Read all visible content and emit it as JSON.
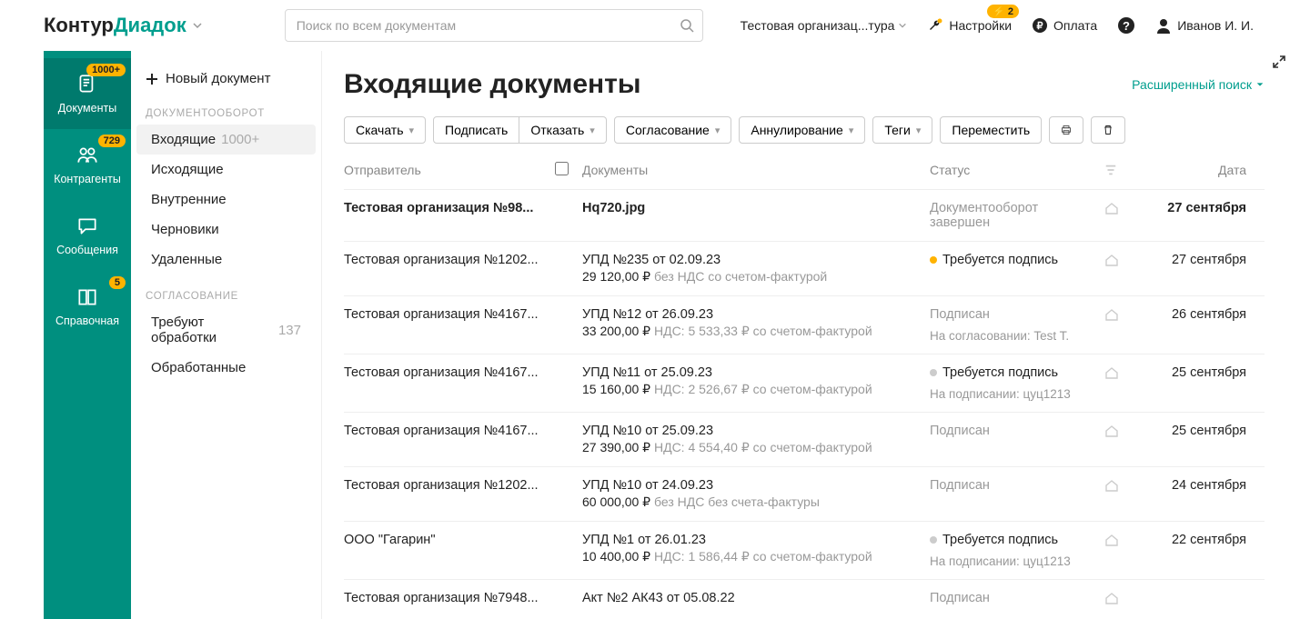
{
  "brand": {
    "part1": "Контур",
    "part2": "Диадок"
  },
  "search": {
    "placeholder": "Поиск по всем документам"
  },
  "top": {
    "org": "Тестовая организац...тура",
    "settings": "Настройки",
    "settings_badge": "⚡ 2",
    "pay": "Оплата",
    "user": "Иванов И. И."
  },
  "rail": {
    "docs": "Документы",
    "docs_badge": "1000+",
    "contr": "Контрагенты",
    "contr_badge": "729",
    "msg": "Сообщения",
    "ref": "Справочная",
    "ref_badge": "5"
  },
  "submenu": {
    "new": "Новый документ",
    "g1": "ДОКУМЕНТООБОРОТ",
    "inbox": "Входящие",
    "inbox_count": "1000+",
    "out": "Исходящие",
    "internal": "Внутренние",
    "drafts": "Черновики",
    "deleted": "Удаленные",
    "g2": "СОГЛАСОВАНИЕ",
    "need": "Требуют обработки",
    "need_count": "137",
    "done": "Обработанные"
  },
  "page": {
    "title": "Входящие документы",
    "adv": "Расширенный поиск"
  },
  "toolbar": {
    "download": "Скачать",
    "sign": "Подписать",
    "reject": "Отказать",
    "approve": "Согласование",
    "annul": "Аннулирование",
    "tags": "Теги",
    "move": "Переместить"
  },
  "thead": {
    "sender": "Отправитель",
    "docs": "Документы",
    "status": "Статус",
    "date": "Дата"
  },
  "rows": [
    {
      "bold": true,
      "sender": "Тестовая организация №98...",
      "title": "Hq720.jpg",
      "sub": "",
      "status": "Документооборот завершен",
      "status_muted": true,
      "dot": "",
      "sub_status": "",
      "date": "27 сентября"
    },
    {
      "sender": "Тестовая организация №1202...",
      "title": "УПД №235 от 02.09.23",
      "price": "29 120,00 ₽",
      "sub": "без НДС  со счетом-фактурой",
      "status": "Требуется подпись",
      "dot": "orange",
      "sub_status": "",
      "date": "27 сентября"
    },
    {
      "sender": "Тестовая организация №4167...",
      "title": "УПД №12 от 26.09.23",
      "price": "33 200,00 ₽",
      "sub": "НДС: 5 533,33 ₽  со счетом-фактурой",
      "status": "Подписан",
      "status_muted": true,
      "dot": "",
      "sub_status": "На согласовании: Test T.",
      "date": "26 сентября"
    },
    {
      "sender": "Тестовая организация №4167...",
      "title": "УПД №11 от 25.09.23",
      "price": "15 160,00 ₽",
      "sub": "НДС: 2 526,67 ₽  со счетом-фактурой",
      "status": "Требуется подпись",
      "dot": "grey",
      "sub_status": "На подписании: цуц1213",
      "date": "25 сентября"
    },
    {
      "sender": "Тестовая организация №4167...",
      "title": "УПД №10 от 25.09.23",
      "price": "27 390,00 ₽",
      "sub": "НДС: 4 554,40 ₽  со счетом-фактурой",
      "status": "Подписан",
      "status_muted": true,
      "dot": "",
      "sub_status": "",
      "date": "25 сентября"
    },
    {
      "sender": "Тестовая организация №1202...",
      "title": "УПД №10 от 24.09.23",
      "price": "60 000,00 ₽",
      "sub": "без НДС  без счета-фактуры",
      "status": "Подписан",
      "status_muted": true,
      "dot": "",
      "sub_status": "",
      "date": "24 сентября"
    },
    {
      "sender": "ООО \"Гагарин\"",
      "title": "УПД №1 от 26.01.23",
      "price": "10 400,00 ₽",
      "sub": "НДС: 1 586,44 ₽  со счетом-фактурой",
      "status": "Требуется подпись",
      "dot": "grey",
      "sub_status": "На подписании: цуц1213",
      "date": "22 сентября"
    },
    {
      "sender": "Тестовая организация №7948...",
      "title": "Акт №2  АК43 от 05.08.22",
      "sub": "",
      "status": "Подписан",
      "status_muted": true,
      "dot": "",
      "sub_status": "",
      "date": ""
    }
  ]
}
